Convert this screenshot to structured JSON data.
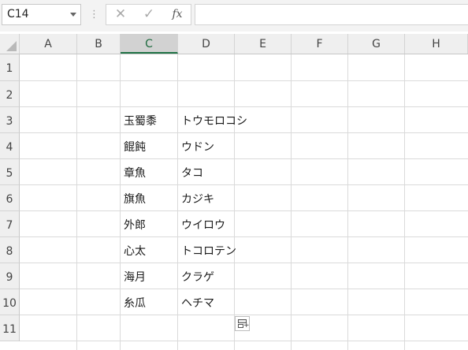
{
  "formula_bar": {
    "name_box": "C14",
    "separator": "⋮",
    "cancel_icon": "✕",
    "enter_icon": "✓",
    "fx_label": "fx",
    "formula": ""
  },
  "columns": [
    "A",
    "B",
    "C",
    "D",
    "E",
    "F",
    "G",
    "H"
  ],
  "selected_column": "C",
  "rows": [
    "1",
    "2",
    "3",
    "4",
    "5",
    "6",
    "7",
    "8",
    "9",
    "10",
    "11"
  ],
  "cells": [
    {
      "c": "玉蜀黍",
      "d": "トウモロコシ"
    },
    {
      "c": "餛飩",
      "d": "ウドン"
    },
    {
      "c": "章魚",
      "d": "タコ"
    },
    {
      "c": "旗魚",
      "d": "カジキ"
    },
    {
      "c": "外郎",
      "d": "ウイロウ"
    },
    {
      "c": "心太",
      "d": "トコロテン"
    },
    {
      "c": "海月",
      "d": "クラゲ"
    },
    {
      "c": "糸瓜",
      "d": "ヘチマ"
    }
  ],
  "icons": {
    "paste_options": "paste-options-icon",
    "select_all": "select-all-triangle"
  }
}
